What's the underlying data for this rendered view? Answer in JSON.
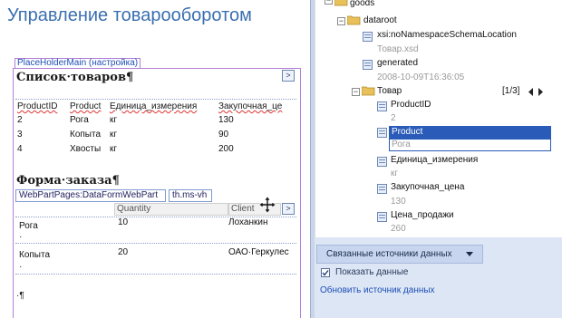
{
  "page": {
    "title": "Управление товарооборотом",
    "placeholder_tag": "PlaceHolderMain (настройка)",
    "pilcrow": "·¶"
  },
  "list_section": {
    "heading": "Список·товаров¶",
    "headers": [
      "ProductID",
      "Product",
      "Единица_измерения",
      "Закупочная_це"
    ],
    "rows": [
      [
        "2",
        "Рога",
        "кг",
        "130"
      ],
      [
        "3",
        "Копыта",
        "кг",
        "90"
      ],
      [
        "4",
        "Хвосты",
        "кг",
        "200"
      ]
    ],
    "arrow_glyph": ">"
  },
  "order_section": {
    "heading": "Форма·заказа¶",
    "webpart_tag": "WebPartPages:DataFormWebPart",
    "tag2": "th.ms-vh",
    "headers": [
      "Quantity",
      "Client"
    ],
    "rows": [
      {
        "product": "Рога",
        "quantity": "10",
        "client": "Лоханкин",
        "bullet": "·"
      },
      {
        "product": "Копыта",
        "quantity": "20",
        "client": "ОАО·Геркулес",
        "bullet": "·"
      }
    ],
    "arrow_glyph": ">"
  },
  "tree": {
    "goods": "goods",
    "dataroot": "dataroot",
    "schema_attr": "xsi:noNamespaceSchemaLocation",
    "schema_value": "Товар.xsd",
    "generated": "generated",
    "generated_value": "2008-10-09T16:36:05",
    "tovar": "Товар",
    "pager": "[1/3]",
    "nodes": [
      {
        "label": "ProductID",
        "value": "2"
      },
      {
        "label": "Product",
        "value": "Рога"
      },
      {
        "label": "Единица_измерения",
        "value": "кг"
      },
      {
        "label": "Закупочная_цена",
        "value": "130"
      },
      {
        "label": "Цена_продажи",
        "value": "260"
      }
    ]
  },
  "actions": {
    "related_sources": "Связанные источники данных",
    "show_data": "Показать данные",
    "refresh": "Обновить источник данных"
  },
  "colors": {
    "title": "#3b6fb0",
    "selection": "#2a5bb8",
    "placeholder_border": "#b27fd9",
    "panel_band": "#dce6f4"
  }
}
